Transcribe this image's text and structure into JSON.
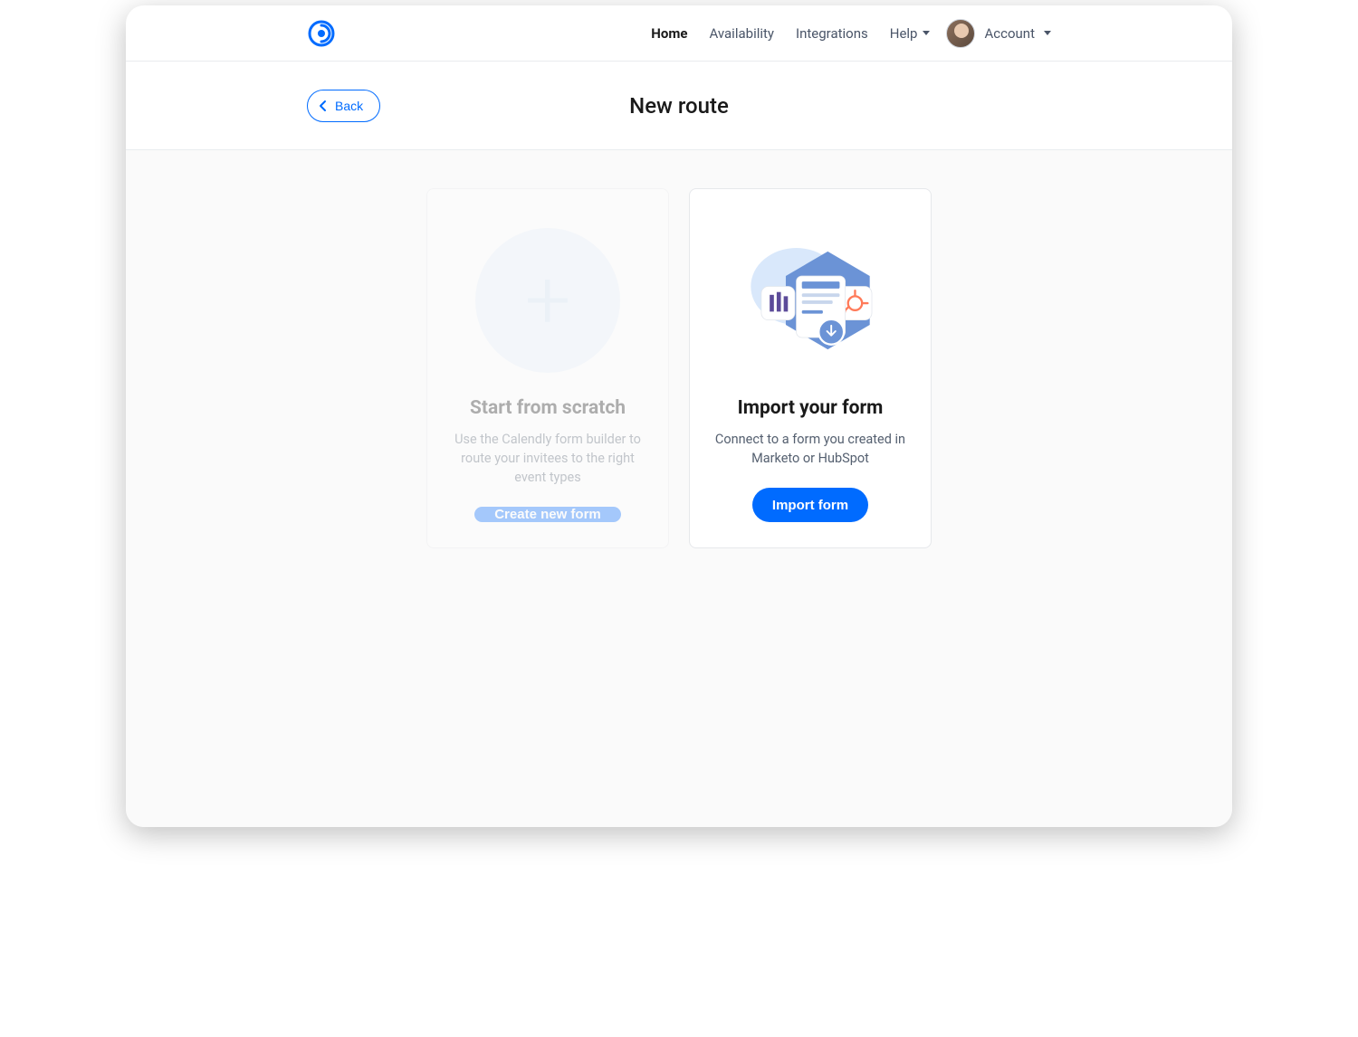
{
  "nav": {
    "home": "Home",
    "availability": "Availability",
    "integrations": "Integrations",
    "help": "Help",
    "account": "Account"
  },
  "subheader": {
    "back": "Back",
    "title": "New route"
  },
  "cards": {
    "scratch": {
      "title": "Start from scratch",
      "description": "Use the Calendly form builder to route your invitees to the right event types",
      "button": "Create new form"
    },
    "import": {
      "title": "Import your form",
      "description": "Connect to a form you created in Marketo or HubSpot",
      "button": "Import form"
    }
  }
}
